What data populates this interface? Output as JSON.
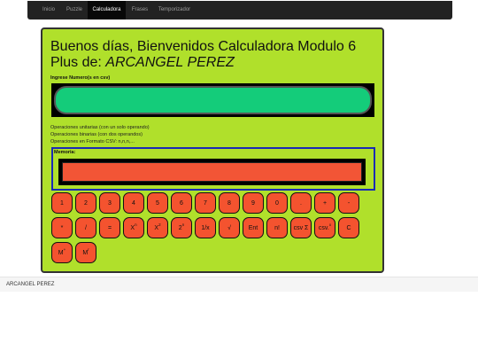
{
  "nav": {
    "items": [
      {
        "label": "Inicio"
      },
      {
        "label": "Puzzle"
      },
      {
        "label": "Calculadora"
      },
      {
        "label": "Frases"
      },
      {
        "label": "Temporizador"
      }
    ]
  },
  "calc": {
    "title": "Buenos días, Bienvenidos Calculadora Modulo 6 Plus de: ",
    "author": "ARCANGEL PEREZ",
    "input_label": "Ingrese Numero(s en csv)",
    "input_value": "",
    "info": [
      "Operaciones unitarias (con un solo operando)",
      "Operaciones binarias (con dos operandos)",
      "Operaciones en Formato CSV: n,n,n,..."
    ],
    "memory_label": "Memoria:",
    "memory_value": "",
    "keys_row1": [
      "1",
      "2",
      "3",
      "4",
      "5",
      "6",
      "7",
      "8",
      "9",
      "0",
      ".",
      "+",
      "-"
    ],
    "keys_row2": [
      {
        "base": "*"
      },
      {
        "base": "/"
      },
      {
        "base": "="
      },
      {
        "base": "X",
        "sup": "n"
      },
      {
        "base": "X",
        "sup": "2"
      },
      {
        "base": "2",
        "sup": "n"
      },
      {
        "base": "1/x"
      },
      {
        "base": "√"
      },
      {
        "base": "Ent"
      },
      {
        "base": "n!"
      },
      {
        "base": "csv Σ"
      },
      {
        "base": "csv.",
        "sup": "x"
      },
      {
        "base": "C"
      }
    ],
    "keys_row3": [
      {
        "base": "M",
        "sup": "+"
      },
      {
        "base": "M",
        "sup": "r"
      }
    ]
  },
  "footer": {
    "text": "ARCANGEL PEREZ"
  }
}
